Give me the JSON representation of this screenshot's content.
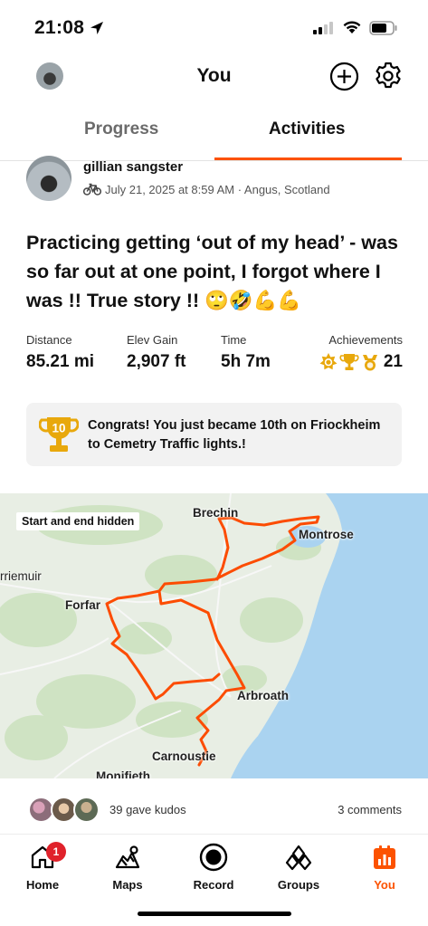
{
  "status_bar": {
    "time": "21:08"
  },
  "header": {
    "title": "You"
  },
  "tabs": [
    {
      "label": "Progress"
    },
    {
      "label": "Activities"
    }
  ],
  "activity": {
    "athlete_name": "gillian sangster",
    "meta": "July 21, 2025 at 8:59 AM · Angus, Scotland",
    "title": "Practicing getting ‘out of my head’ - was so far out at one point, I forgot where I was !! True story !! 🙄🤣💪💪",
    "stats": {
      "distance": {
        "label": "Distance",
        "value": "85.21 mi"
      },
      "elev_gain": {
        "label": "Elev Gain",
        "value": "2,907 ft"
      },
      "time": {
        "label": "Time",
        "value": "5h 7m"
      },
      "achievements": {
        "label": "Achievements",
        "value": "21"
      }
    },
    "congrats": {
      "rank_badge": "10",
      "text": "Congrats! You just became 10th on Friockheim to Cemetry Traffic lights.!"
    },
    "map": {
      "tag": "Start and end hidden",
      "places": [
        "Brechin",
        "Montrose",
        "rriemuir",
        "Forfar",
        "Arbroath",
        "Carnoustie",
        "Monifieth"
      ],
      "route_color": "#fc4c02"
    },
    "kudos": "39 gave kudos",
    "comments": "3 comments"
  },
  "nav": {
    "items": [
      {
        "label": "Home",
        "icon": "home-icon",
        "badge": "1"
      },
      {
        "label": "Maps",
        "icon": "maps-icon"
      },
      {
        "label": "Record",
        "icon": "record-icon"
      },
      {
        "label": "Groups",
        "icon": "groups-icon"
      },
      {
        "label": "You",
        "icon": "you-icon",
        "active": true
      }
    ]
  },
  "colors": {
    "accent": "#fc5200",
    "badge": "#e0222b",
    "trophy": "#e8a80c"
  }
}
